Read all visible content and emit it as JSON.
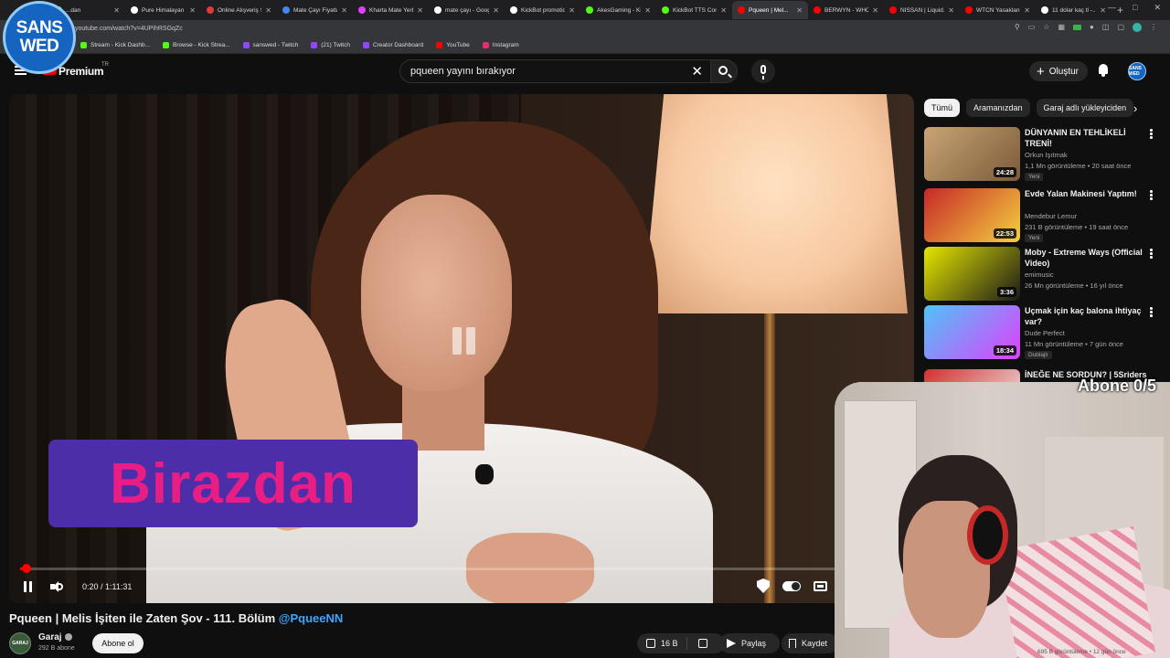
{
  "browser": {
    "tabs": [
      {
        "title": "...dan",
        "color": "#53fc18"
      },
      {
        "title": "Pure Himalayan S...",
        "color": "#ffffff"
      },
      {
        "title": "Online Alışveriş S...",
        "color": "#e53935"
      },
      {
        "title": "Mate Çayı Fiyatla...",
        "color": "#4285f4"
      },
      {
        "title": "Kharta Mate Yerb...",
        "color": "#e040fb"
      },
      {
        "title": "mate çayı - Goog...",
        "color": "#ffffff"
      },
      {
        "title": "KickBot promotio...",
        "color": "#ffffff"
      },
      {
        "title": "AkesGaming - Ki...",
        "color": "#53fc18"
      },
      {
        "title": "KickBot TTS Com...",
        "color": "#53fc18"
      },
      {
        "title": "Pqueen | Mel...",
        "color": "#ff0000",
        "active": true
      },
      {
        "title": "BERWYN - WHO...",
        "color": "#ff0000"
      },
      {
        "title": "NISSAN | Liquid...",
        "color": "#ff0000"
      },
      {
        "title": "WTCN Yasaklanm...",
        "color": "#ff0000"
      },
      {
        "title": "11 dolar kaç tl -...",
        "color": "#ffffff"
      }
    ],
    "new_tab": "+",
    "url": "youtube.com/watch?v=4UPihRSGqZc",
    "bookmarks": [
      {
        "label": "Stream - Kick Dashb...",
        "color": "#53fc18"
      },
      {
        "label": "Browse - Kick Strea...",
        "color": "#53fc18"
      },
      {
        "label": "sanswed - Twitch",
        "color": "#9146ff"
      },
      {
        "label": "(21) Twitch",
        "color": "#9146ff"
      },
      {
        "label": "Creator Dashboard",
        "color": "#9146ff"
      },
      {
        "label": "YouTube",
        "color": "#ff0000"
      },
      {
        "label": "Instagram",
        "color": "#e1306c"
      }
    ]
  },
  "overlay": {
    "logo_line1": "SANS",
    "logo_line2": "WED",
    "abone": "Abone 0/5"
  },
  "header": {
    "brand": "Premium",
    "region": "TR",
    "search_query": "pqueen yayını bırakıyor",
    "create_label": "Oluştur",
    "avatar_text": "SANS WED"
  },
  "player": {
    "caption": "Birazdan",
    "time": "0:20 / 1:11:31",
    "progress": 0.005
  },
  "video": {
    "title": "Pqueen | Melis İşiten ile Zaten Şov - 111. Bölüm",
    "handle": "@PqueeNN",
    "channel": "Garaj",
    "channel_avatar": "GARAJ",
    "subscribers": "292 B abone",
    "subscribe_label": "Abone ol",
    "likes": "16 B",
    "share_label": "Paylaş",
    "save_label": "Kaydet"
  },
  "sidebar": {
    "chips": [
      {
        "label": "Tümü",
        "active": true
      },
      {
        "label": "Aramanızdan",
        "active": false
      },
      {
        "label": "Garaj adlı yükleyiciden",
        "active": false
      }
    ],
    "recommendations": [
      {
        "title": "DÜNYANIN EN TEHLİKELİ TRENİ!",
        "channel": "Orkun Işıtmak",
        "stats": "1,1 Mn görüntüleme • 20 saat önce",
        "badge": "Yeni",
        "duration": "24:28",
        "colors": [
          "#c9a574",
          "#7a5a3a"
        ]
      },
      {
        "title": "Evde Yalan Makinesi Yaptım!",
        "channel": "Mendebur Lemur",
        "stats": "231 B görüntüleme • 19 saat önce",
        "badge": "Yeni",
        "duration": "22:53",
        "colors": [
          "#c62828",
          "#f4d03f"
        ]
      },
      {
        "title": "Moby - Extreme Ways (Official Video)",
        "channel": "emimusic",
        "stats": "26 Mn görüntüleme • 16 yıl önce",
        "badge": "",
        "duration": "3:36",
        "colors": [
          "#e6e600",
          "#1a1a1a"
        ]
      },
      {
        "title": "Uçmak için kaç balona ihtiyaç var?",
        "channel": "Dude Perfect",
        "stats": "11 Mn görüntüleme • 7 gün önce",
        "badge": "Dublajlı",
        "duration": "18:34",
        "colors": [
          "#4fc3f7",
          "#e040fb"
        ]
      },
      {
        "title": "İNEĞE NE SORDUN? | 5Sriders |",
        "channel": "",
        "stats": "",
        "badge": "",
        "duration": "",
        "colors": [
          "#d32f2f",
          "#eeeeee"
        ]
      }
    ],
    "bottom_meta": "695 B görüntüleme • 12 gün önce"
  }
}
